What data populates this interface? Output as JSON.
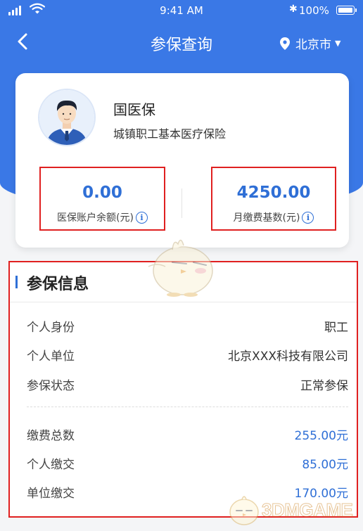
{
  "status_bar": {
    "time": "9:41 AM",
    "battery": "100%"
  },
  "nav": {
    "title": "参保查询",
    "city": "北京市"
  },
  "profile": {
    "name": "国医保",
    "insurance_type": "城镇职工基本医疗保险"
  },
  "stats": [
    {
      "value": "0.00",
      "label": "医保账户余额(元)"
    },
    {
      "value": "4250.00",
      "label": "月缴费基数(元)"
    }
  ],
  "section": {
    "title": "参保信息",
    "basic": [
      {
        "key": "个人身份",
        "value": "职工"
      },
      {
        "key": "个人单位",
        "value": "北京XXX科技有限公司"
      },
      {
        "key": "参保状态",
        "value": "正常参保"
      }
    ],
    "payments": [
      {
        "key": "缴费总数",
        "value": "255.00元"
      },
      {
        "key": "个人缴交",
        "value": "85.00元"
      },
      {
        "key": "单位缴交",
        "value": "170.00元"
      }
    ]
  },
  "watermark": {
    "text": "3DMGAME"
  },
  "colors": {
    "primary": "#3a78e6",
    "accent_text": "#2f6fd6",
    "highlight_border": "#e02020"
  }
}
